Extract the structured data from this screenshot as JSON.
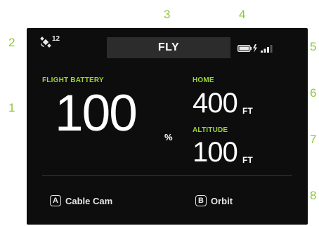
{
  "callouts": [
    "1",
    "2",
    "3",
    "4",
    "5",
    "6",
    "7",
    "8"
  ],
  "status_bar": {
    "gps_icon": "satellite-icon",
    "gps_count": "12",
    "mode": "FLY",
    "battery_icon": "battery-charging-icon",
    "signal_icon": "signal-bars-icon"
  },
  "flight_battery": {
    "label": "FLIGHT BATTERY",
    "value": "100",
    "unit": "%"
  },
  "home": {
    "label": "HOME",
    "value": "400",
    "unit": "FT"
  },
  "altitude": {
    "label": "ALTITUDE",
    "value": "100",
    "unit": "FT"
  },
  "buttons": {
    "a_key": "A",
    "a_label": "Cable Cam",
    "b_key": "B",
    "b_label": "Orbit"
  },
  "colors": {
    "accent_green": "#9bd43c",
    "callout_green": "#8dc63f",
    "screen_bg": "#0d0d0d",
    "mode_bar_bg": "#2c2c2c"
  }
}
